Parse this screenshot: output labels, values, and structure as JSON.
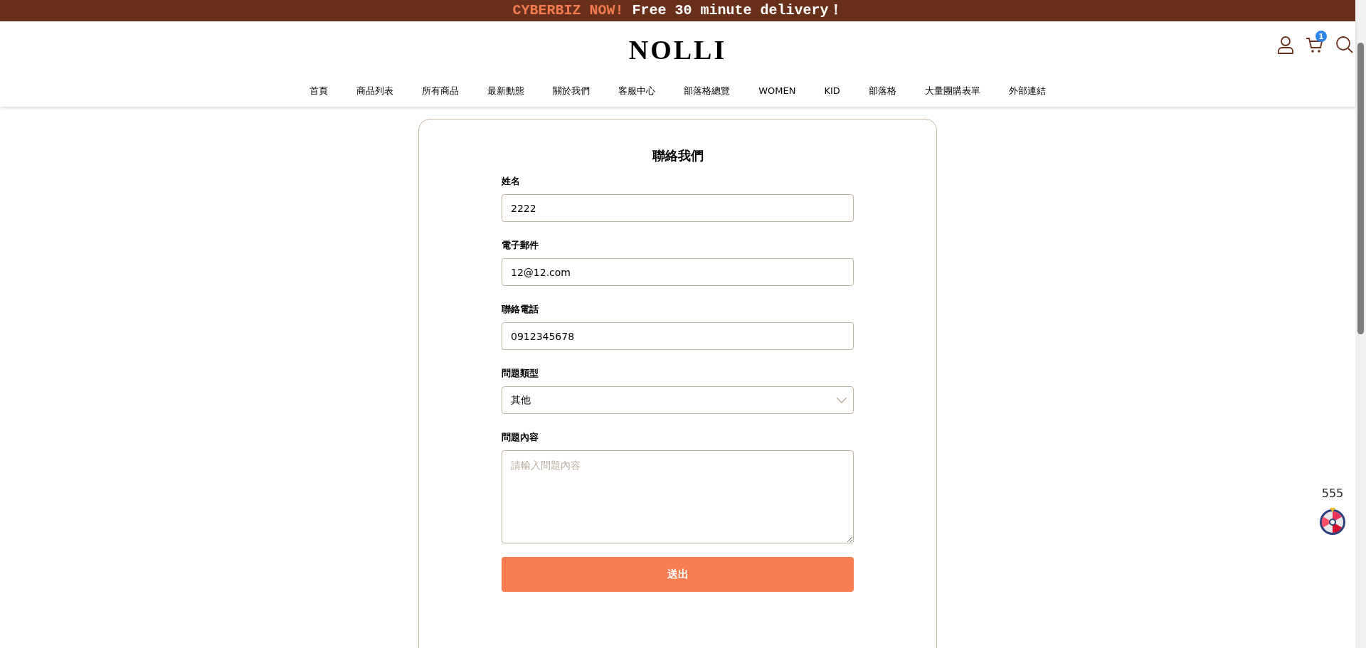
{
  "banner": {
    "highlight": "CYBERBIZ NOW!",
    "text": "Free 30 minute delivery！"
  },
  "header": {
    "logo": "NOLLI",
    "cart_count": "1"
  },
  "nav": [
    "首頁",
    "商品列表",
    "所有商品",
    "最新動態",
    "關於我們",
    "客服中心",
    "部落格總覽",
    "WOMEN",
    "KID",
    "部落格",
    "大量團購表單",
    "外部連結"
  ],
  "form": {
    "title": "聯絡我們",
    "fields": [
      {
        "kind": "text",
        "label": "姓名",
        "value": "2222"
      },
      {
        "kind": "text",
        "label": "電子郵件",
        "value": "12@12.com"
      },
      {
        "kind": "text",
        "label": "聯絡電話",
        "value": "0912345678"
      },
      {
        "kind": "select",
        "label": "問題類型",
        "value": "其他"
      },
      {
        "kind": "textarea",
        "label": "問題內容",
        "placeholder": "請輸入問題內容"
      }
    ],
    "submit": "送出"
  },
  "widget": {
    "label": "555"
  }
}
